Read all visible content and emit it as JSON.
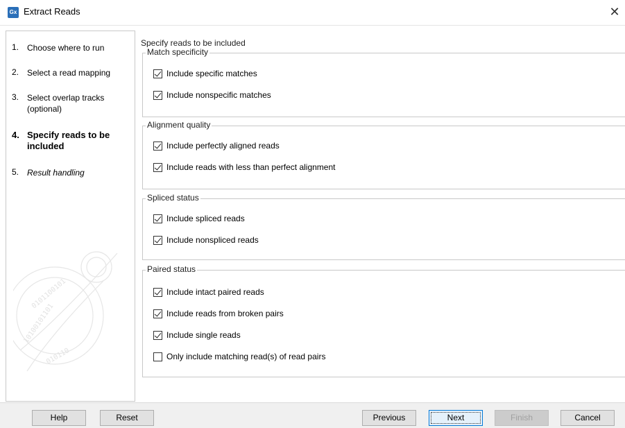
{
  "window": {
    "title": "Extract Reads",
    "app_icon_text": "Gx",
    "close_glyph": "✕"
  },
  "sidebar": {
    "steps": [
      {
        "number": "1.",
        "label": "Choose where to run"
      },
      {
        "number": "2.",
        "label": "Select a read mapping"
      },
      {
        "number": "3.",
        "label": "Select overlap tracks (optional)"
      },
      {
        "number": "4.",
        "label": "Specify reads to be included"
      },
      {
        "number": "5.",
        "label": "Result handling"
      }
    ],
    "active_step": 4
  },
  "content": {
    "title": "Specify reads to be included",
    "groups": [
      {
        "legend": "Match specificity",
        "options": [
          {
            "label": "Include specific matches",
            "checked": true
          },
          {
            "label": "Include nonspecific matches",
            "checked": true
          }
        ]
      },
      {
        "legend": "Alignment quality",
        "options": [
          {
            "label": "Include perfectly aligned reads",
            "checked": true
          },
          {
            "label": "Include reads with less than perfect alignment",
            "checked": true
          }
        ]
      },
      {
        "legend": "Spliced status",
        "options": [
          {
            "label": "Include spliced reads",
            "checked": true
          },
          {
            "label": "Include nonspliced reads",
            "checked": true
          }
        ]
      },
      {
        "legend": "Paired status",
        "options": [
          {
            "label": "Include intact paired reads",
            "checked": true
          },
          {
            "label": "Include reads from broken pairs",
            "checked": true
          },
          {
            "label": "Include single reads",
            "checked": true
          },
          {
            "label": "Only include matching read(s) of read pairs",
            "checked": false
          }
        ]
      }
    ]
  },
  "footer": {
    "help": "Help",
    "reset": "Reset",
    "previous": "Previous",
    "next": "Next",
    "finish": "Finish",
    "cancel": "Cancel"
  },
  "colors": {
    "app_icon": "#2a6fb8",
    "default_button_border": "#0078d7"
  }
}
